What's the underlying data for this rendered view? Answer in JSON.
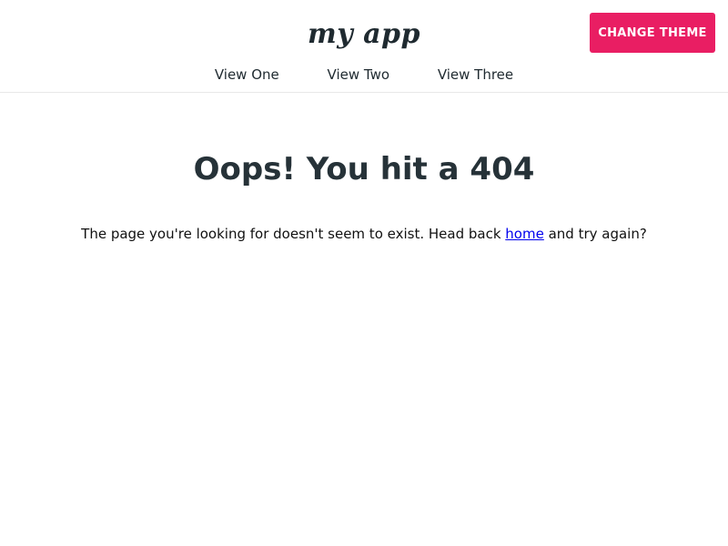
{
  "header": {
    "logo_text": "my app",
    "theme_button_label": "CHANGE THEME",
    "nav": [
      {
        "label": "View One"
      },
      {
        "label": "View Two"
      },
      {
        "label": "View Three"
      }
    ]
  },
  "main": {
    "title": "Oops! You hit a 404",
    "message_before": "The page you're looking for doesn't seem to exist. Head back ",
    "home_link": "home",
    "message_after": " and try again?"
  },
  "colors": {
    "accent": "#e91e63",
    "heading": "#263238",
    "link": "#0000ee"
  }
}
